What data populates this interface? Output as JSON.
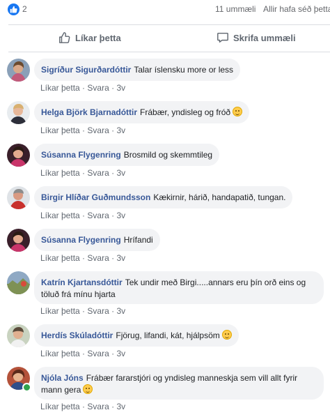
{
  "summary": {
    "like_count": "2",
    "comment_count": "11 ummæli",
    "seen_by": "Allir hafa séð þetta"
  },
  "actions": {
    "like_label": "Líkar þetta",
    "comment_label": "Skrifa ummæli"
  },
  "comment_meta": {
    "like": "Líkar þetta",
    "dot": "·",
    "reply": "Svara",
    "time": "3v"
  },
  "comments": [
    {
      "author": "Sigríður Sigurðardóttir",
      "text": "Talar íslensku more or less"
    },
    {
      "author": "Helga Björk Bjarnadóttir",
      "text": "Frábær, yndisleg og fróð"
    },
    {
      "author": "Súsanna Flygenring",
      "text": "Brosmild og skemmtileg"
    },
    {
      "author": "Birgir Hlíðar Guðmundsson",
      "text": "Kækirnir, hárið, handapatið, tungan."
    },
    {
      "author": "Súsanna Flygenring",
      "text": "Hrífandi"
    },
    {
      "author": "Katrín Kjartansdóttir",
      "text": "Tek undir með Birgi.....annars eru þín orð eins og töluð frá mínu hjarta"
    },
    {
      "author": "Herdís Skúladóttir",
      "text": "Fjörug, lifandi, kát, hjálpsöm"
    },
    {
      "author": "Njóla Jóns",
      "text": "Frábær fararstjóri og yndisleg manneskja sem vill allt fyrir mann gera"
    }
  ],
  "colors": {
    "accent": "#1877f2",
    "author": "#385898",
    "bubble": "#f2f3f5",
    "muted": "#606770"
  }
}
